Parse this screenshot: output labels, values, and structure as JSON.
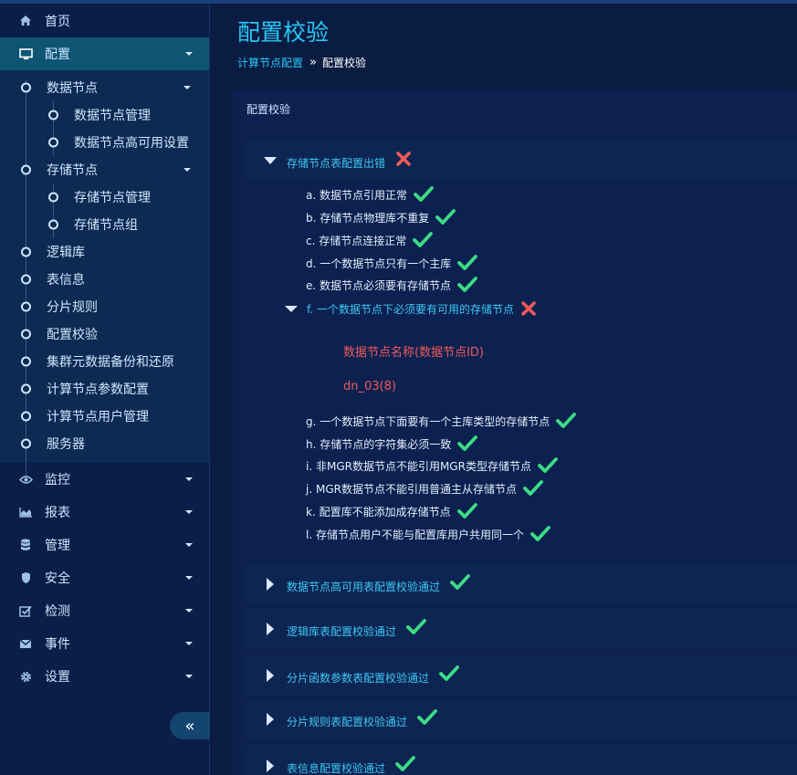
{
  "sidebar": {
    "items": [
      {
        "label": "首页",
        "icon": "home-icon"
      },
      {
        "label": "配置",
        "icon": "monitor-icon"
      },
      {
        "label": "监控",
        "icon": "eye-icon"
      },
      {
        "label": "报表",
        "icon": "area-chart-icon"
      },
      {
        "label": "管理",
        "icon": "database-icon"
      },
      {
        "label": "安全",
        "icon": "shield-icon"
      },
      {
        "label": "检测",
        "icon": "checkbox-icon"
      },
      {
        "label": "事件",
        "icon": "envelope-icon"
      },
      {
        "label": "设置",
        "icon": "gear-icon"
      }
    ],
    "config_children": {
      "data_node": {
        "label": "数据节点",
        "children": [
          "数据节点管理",
          "数据节点高可用设置"
        ]
      },
      "storage_node": {
        "label": "存储节点",
        "children": [
          "存储节点管理",
          "存储节点组"
        ]
      },
      "others": [
        "逻辑库",
        "表信息",
        "分片规则",
        "配置校验",
        "集群元数据备份和还原",
        "计算节点参数配置",
        "计算节点用户管理",
        "服务器"
      ]
    },
    "collapse_label": "«"
  },
  "main": {
    "title": "配置校验",
    "breadcrumb": {
      "parent": "计算节点配置",
      "separator": "»",
      "current": "配置校验"
    },
    "panel_title": "配置校验",
    "expanded_section": {
      "label": "存储节点表配置出错",
      "status": "error",
      "items": [
        {
          "text": "a. 数据节点引用正常",
          "status": "ok"
        },
        {
          "text": "b. 存储节点物理库不重复",
          "status": "ok"
        },
        {
          "text": "c. 存储节点连接正常",
          "status": "ok"
        },
        {
          "text": "d. 一个数据节点只有一个主库",
          "status": "ok"
        },
        {
          "text": "e. 数据节点必须要有存储节点",
          "status": "ok"
        }
      ],
      "failed_item": {
        "text": "f. 一个数据节点下必须要有可用的存储节点",
        "status": "error",
        "error_header": "数据节点名称(数据节点ID)",
        "error_value": "dn_03(8)"
      },
      "items_after": [
        {
          "text": "g. 一个数据节点下面要有一个主库类型的存储节点",
          "status": "ok"
        },
        {
          "text": "h. 存储节点的字符集必须一致",
          "status": "ok"
        },
        {
          "text": "i. 非MGR数据节点不能引用MGR类型存储节点",
          "status": "ok"
        },
        {
          "text": "j. MGR数据节点不能引用普通主从存储节点",
          "status": "ok"
        },
        {
          "text": "k. 配置库不能添加成存储节点",
          "status": "ok"
        },
        {
          "text": "l. 存储节点用户不能与配置库用户共用同一个",
          "status": "ok"
        }
      ]
    },
    "collapsed_sections": [
      {
        "label": "数据节点高可用表配置校验通过",
        "status": "ok"
      },
      {
        "label": "逻辑库表配置校验通过",
        "status": "ok"
      },
      {
        "label": "分片函数参数表配置校验通过",
        "status": "ok"
      },
      {
        "label": "分片规则表配置校验通过",
        "status": "ok"
      },
      {
        "label": "表信息配置校验通过",
        "status": "ok"
      }
    ]
  },
  "colors": {
    "accent": "#29c6f5",
    "ok": "#3ddc84",
    "error": "#f25a5a",
    "sidebar_bg": "#0b1e48",
    "active_bg": "#0e5573"
  }
}
